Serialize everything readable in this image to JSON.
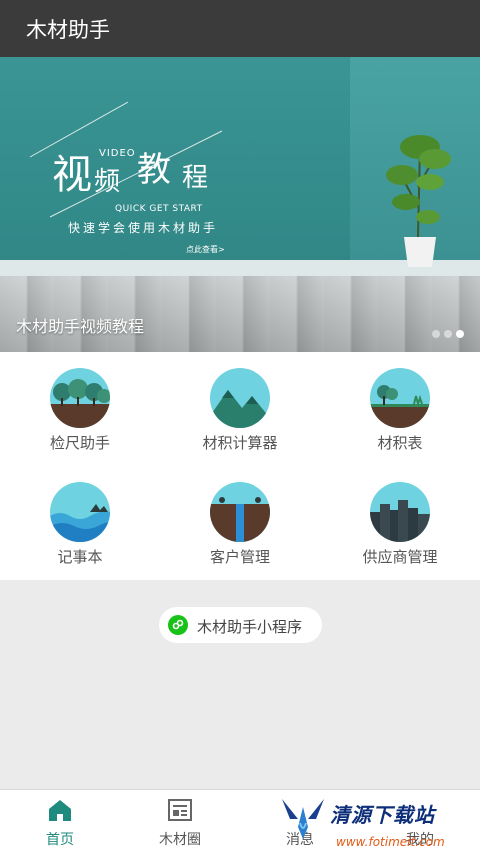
{
  "app": {
    "title": "木材助手"
  },
  "banner": {
    "chars": [
      "视",
      "频",
      "教",
      "程"
    ],
    "video_en": "VIDEO",
    "quick_en": "QUICK GET START",
    "quick_cn": "快速学会使用木材助手",
    "check_more": "点此查看>",
    "caption": "木材助手视频教程",
    "slide_count": 3,
    "active_slide": 3
  },
  "menu": {
    "items": [
      {
        "label": "检尺助手",
        "icon": "forest-icon"
      },
      {
        "label": "材积计算器",
        "icon": "mountain-icon"
      },
      {
        "label": "材积表",
        "icon": "tree-field-icon"
      },
      {
        "label": "记事本",
        "icon": "wave-icon"
      },
      {
        "label": "客户管理",
        "icon": "waterfall-icon"
      },
      {
        "label": "供应商管理",
        "icon": "city-icon"
      }
    ]
  },
  "mini_program": {
    "label": "木材助手小程序",
    "icon": "wechat-link-icon"
  },
  "nav": {
    "items": [
      {
        "label": "首页",
        "icon": "home-icon"
      },
      {
        "label": "木材圈",
        "icon": "news-icon"
      },
      {
        "label": "消息",
        "icon": "message-icon"
      },
      {
        "label": "我的",
        "icon": "profile-icon"
      }
    ],
    "active": "首页"
  },
  "colors": {
    "appbar": "#3b3b3b",
    "accent": "#1f8a7e",
    "banner_teal": "#3a9594",
    "icon_sky": "#6fd2e0",
    "icon_ground": "#5a3a2a"
  },
  "watermark": {
    "text": "清源下载站",
    "url": "www.fotimeit.com"
  }
}
